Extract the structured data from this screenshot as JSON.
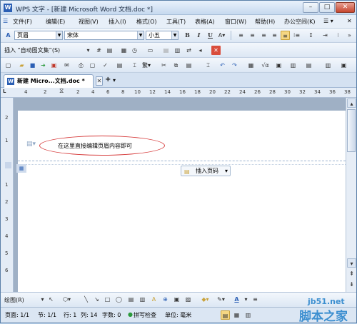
{
  "window": {
    "title": "WPS 文字 - [新建 Microsoft Word 文档.doc *]",
    "app_icon": "W"
  },
  "menu": {
    "items": [
      "文件(F)",
      "编辑(E)",
      "视图(V)",
      "插入(I)",
      "格式(O)",
      "工具(T)",
      "表格(A)",
      "窗口(W)",
      "帮助(H)",
      "办公空间(K)"
    ]
  },
  "format_bar": {
    "style": "页眉",
    "font": "宋体",
    "size": "小五",
    "bold": "B",
    "italic": "I",
    "underline": "U"
  },
  "autotext_bar": {
    "insert_label": "插入 “自动图文集”(S)"
  },
  "doc_tab": {
    "label": "新建 Micro...文档.doc *",
    "new": "+"
  },
  "ruler": {
    "numbers": [
      "4",
      "2",
      "2",
      "4",
      "6",
      "8",
      "10",
      "12",
      "14",
      "16",
      "18",
      "20",
      "22",
      "24",
      "26",
      "28",
      "30",
      "32",
      "34",
      "36",
      "38"
    ]
  },
  "header_area": {
    "text": "在这里直接编辑页眉内容即可",
    "insert_page_number": "插入页码"
  },
  "draw_bar": {
    "label": "绘图(R)"
  },
  "status": {
    "page": "页面: 1/1",
    "section": "节: 1/1",
    "row": "行: 1",
    "col": "列: 14",
    "words": "字数: 0",
    "spell": "拼写检查",
    "unit": "单位: 毫米"
  },
  "watermark": {
    "site": "jb51.net",
    "brand": "脚本之家"
  },
  "colors": {
    "accent": "#2b5fb4",
    "annotation": "#d63b3b"
  }
}
